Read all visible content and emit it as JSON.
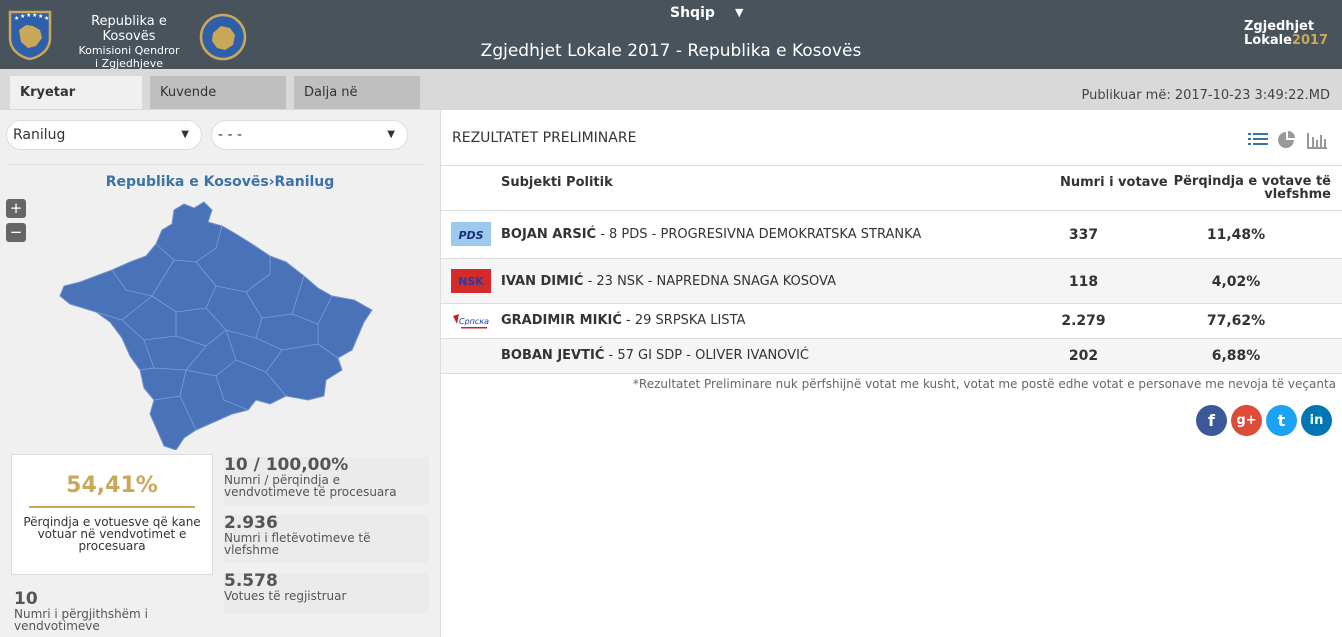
{
  "header": {
    "org_name": "Republika e Kosovës",
    "org_sub1": "Komisioni Qendror",
    "org_sub2": "i Zgjedhjeve",
    "language": "Shqip",
    "title": "Zgjedhjet Lokale 2017 - Republika e Kosovës",
    "brand_line1": "Zgjedhjet",
    "brand_line2": "Lokale",
    "brand_year": "2017"
  },
  "tabs": [
    {
      "label": "Kryetar Komune",
      "active": true
    },
    {
      "label": "Kuvende Komunale",
      "active": false
    },
    {
      "label": "Dalja në zgjedhje",
      "active": false
    }
  ],
  "published": "Publikuar më: 2017-10-23 3:49:22.MD",
  "filters": {
    "municipality": "Ranilug",
    "secondary": "- - -"
  },
  "breadcrumb": {
    "root": "Republika e Kosovës",
    "sep": "›",
    "current": "Ranilug"
  },
  "map_zoom": {
    "in": "+",
    "out": "−"
  },
  "turnout": {
    "percent": "54,41%",
    "label": "Përqindja e votuesve që kane votuar në vendvotimet e procesuara"
  },
  "stats": {
    "stations_processed": {
      "value": "10 / 100,00%",
      "label": "Numri / përqindja e vendvotimeve të procesuara"
    },
    "valid_ballots": {
      "value": "2.936",
      "label": "Numri i fletëvotimeve të vlefshme"
    },
    "registered": {
      "value": "5.578",
      "label": "Votues të regjistruar"
    },
    "total_stations": {
      "value": "10",
      "label": "Numri i përgjithshëm i vendvotimeve"
    }
  },
  "results": {
    "title": "REZULTATET PRELIMINARE",
    "col_subject": "Subjekti Politik",
    "col_votes": "Numri i votave",
    "col_share": "Përqindja e votave të vlefshme",
    "rows": [
      {
        "candidate": "BOJAN ARSIĆ",
        "party": " - 8 PDS - PROGRESIVNA DEMOKRATSKA STRANKA",
        "votes": "337",
        "share": "11,48%",
        "logo_text": "PDS"
      },
      {
        "candidate": "IVAN DIMIĆ",
        "party": " - 23 NSK - NAPREDNA SNAGA KOSOVA",
        "votes": "118",
        "share": "4,02%",
        "logo_text": "NSK"
      },
      {
        "candidate": "GRADIMIR MIKIĆ",
        "party": " - 29 SRPSKA LISTA",
        "votes": "2.279",
        "share": "77,62%",
        "logo_text": "Српска"
      },
      {
        "candidate": "BOBAN JEVTIĆ",
        "party": " - 57 GI SDP - OLIVER IVANOVIĆ",
        "votes": "202",
        "share": "6,88%",
        "logo_text": ""
      }
    ],
    "note": "*Rezultatet Preliminare nuk përfshijnë votat me kusht, votat me postë edhe votat e personave me nevoja të veçanta"
  },
  "social": {
    "facebook": "f",
    "google": "g+",
    "twitter": "t",
    "linkedin": "in"
  },
  "colors": {
    "header": "#48535b",
    "accent": "#c9a959",
    "map": "#4a72b8",
    "link": "#3a73a8"
  }
}
